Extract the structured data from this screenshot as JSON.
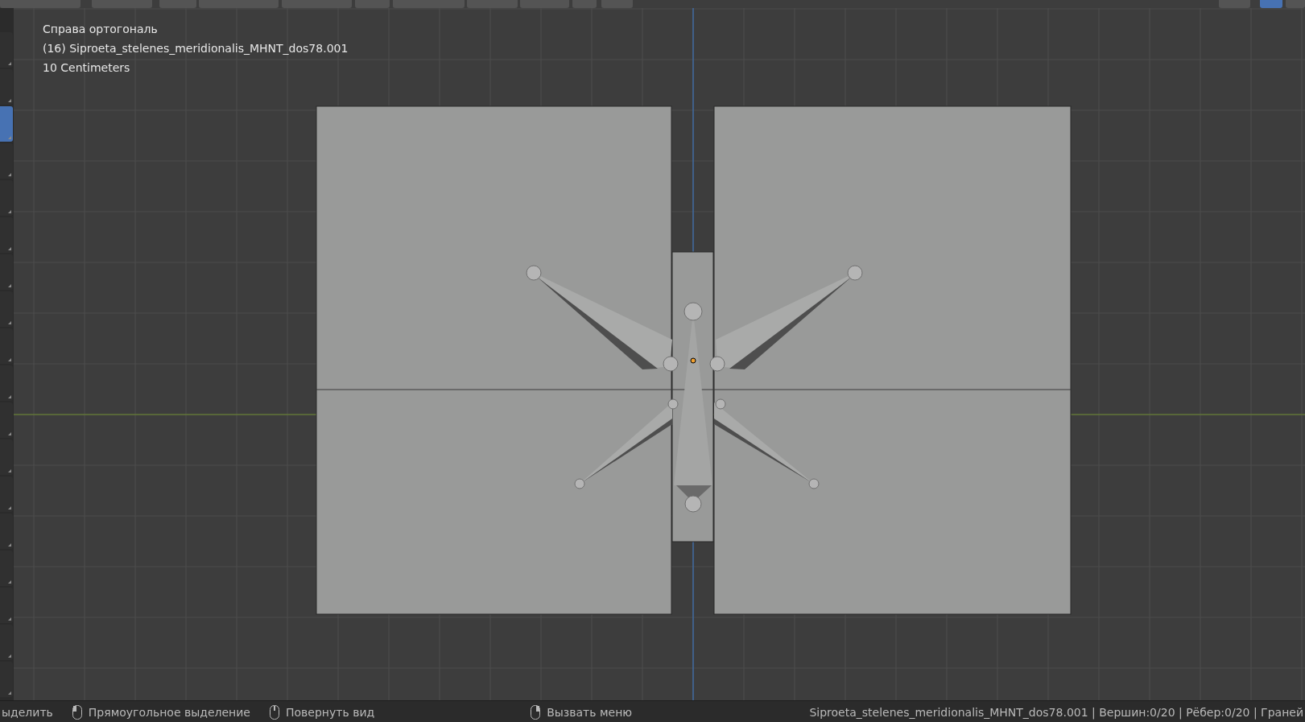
{
  "viewport": {
    "view_name": "Справа ортогональ",
    "object_name": "(16) Siproeta_stelenes_meridionalis_MHNT_dos78.001",
    "grid_scale": "10 Centimeters"
  },
  "toolbar": {
    "tools": [
      {
        "selected": false
      },
      {
        "selected": false
      },
      {
        "selected": true
      },
      {
        "selected": false
      },
      {
        "selected": false
      },
      {
        "selected": false
      },
      {
        "selected": false
      },
      {
        "selected": false
      },
      {
        "selected": false
      },
      {
        "selected": false
      },
      {
        "selected": false
      },
      {
        "selected": false
      },
      {
        "selected": false
      },
      {
        "selected": false
      },
      {
        "selected": false
      },
      {
        "selected": false
      },
      {
        "selected": false
      },
      {
        "selected": false
      }
    ]
  },
  "status_bar": {
    "hints": [
      {
        "kind": "none",
        "label": "ыделить"
      },
      {
        "kind": "mouse-left",
        "label": "Прямоугольное выделение"
      },
      {
        "kind": "mouse-middle",
        "label": "Повернуть вид"
      },
      {
        "kind": "mouse-right",
        "label": "Вызвать меню"
      }
    ],
    "stats": "Siproeta_stelenes_meridionalis_MHNT_dos78.001 | Вершин:0/20 | Рёбер:0/20 | Граней"
  }
}
